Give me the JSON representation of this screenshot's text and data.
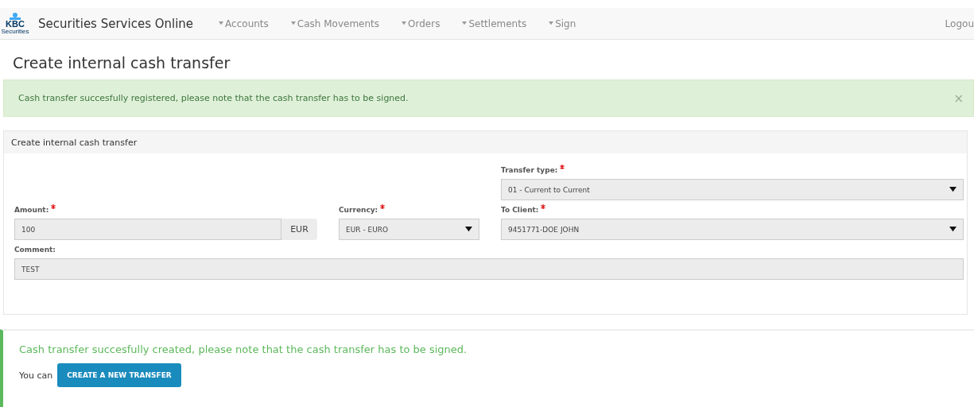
{
  "navbar": {
    "logo": {
      "letters": "KBC",
      "caption": "Securities"
    },
    "brand": "Securities Services Online",
    "menu": [
      {
        "label": "Accounts"
      },
      {
        "label": "Cash Movements"
      },
      {
        "label": "Orders"
      },
      {
        "label": "Settlements"
      },
      {
        "label": "Sign"
      }
    ],
    "logout": "Logou"
  },
  "page_title": "Create internal cash transfer",
  "alert": {
    "text": "Cash transfer succesfully registered, please note that the cash transfer has to be signed.",
    "close": "×"
  },
  "panel": {
    "heading": "Create internal cash transfer",
    "transfer_type": {
      "label": "Transfer type:",
      "required": true,
      "value": "01 - Current to Current"
    },
    "amount": {
      "label": "Amount:",
      "required": true,
      "value": "100",
      "addon": "EUR"
    },
    "currency": {
      "label": "Currency:",
      "required": true,
      "value": "EUR - EURO"
    },
    "to_client": {
      "label": "To Client:",
      "required": true,
      "value": "9451771-DOE JOHN"
    },
    "comment": {
      "label": "Comment:",
      "required": false,
      "value": "TEST"
    }
  },
  "callout": {
    "message": "Cash transfer succesfully created, please note that the cash transfer has to be signed.",
    "prefix": "You can",
    "button": "CREATE A NEW TRANSFER"
  }
}
